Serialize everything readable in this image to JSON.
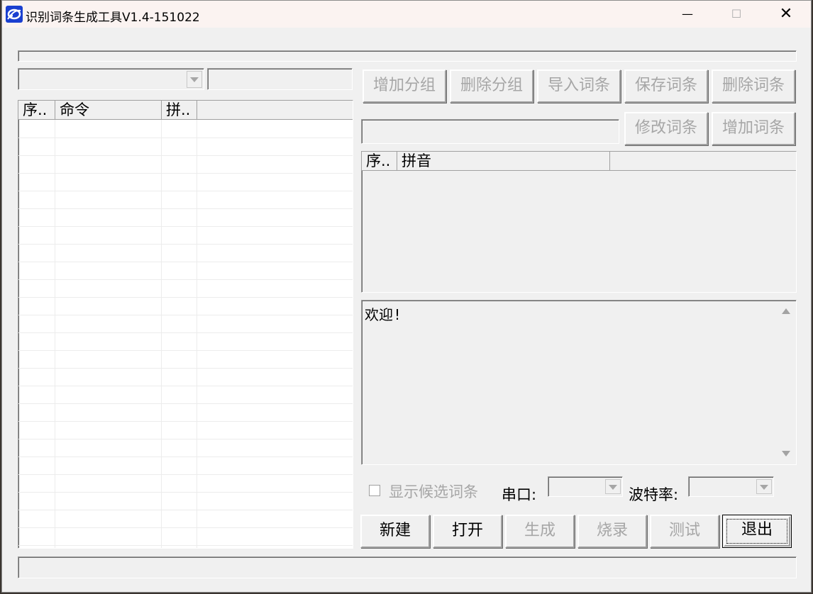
{
  "window": {
    "title": "识别词条生成工具V1.4-151022",
    "minimize_glyph": "—",
    "maximize_glyph": "☐",
    "close_glyph": "✕"
  },
  "left_panel": {
    "group_combo": {
      "value": ""
    },
    "group_name_input": {
      "value": ""
    },
    "command_table": {
      "columns": [
        "序..",
        "命令",
        "拼..",
        ""
      ],
      "rows": []
    }
  },
  "toolbar": {
    "add_group": "增加分组",
    "delete_group": "删除分组",
    "import_words": "导入词条",
    "save_words": "保存词条",
    "delete_word": "删除词条",
    "modify_word": "修改词条",
    "add_word": "增加词条"
  },
  "word_input": {
    "value": ""
  },
  "pinyin_table": {
    "columns": [
      "序..",
      "拼音",
      ""
    ],
    "rows": []
  },
  "log": {
    "text": "欢迎!"
  },
  "options": {
    "show_candidates_label": "显示候选词条",
    "show_candidates_checked": false,
    "serial_port_label": "串口:",
    "serial_port_value": "",
    "baud_rate_label": "波特率:",
    "baud_rate_value": ""
  },
  "actions": {
    "new": "新建",
    "open": "打开",
    "generate": "生成",
    "burn": "烧录",
    "test": "测试",
    "exit": "退出"
  },
  "colors": {
    "window_bg": "#f0f0f0",
    "titlebar_bg": "#fbf3f1",
    "disabled_text": "#a6a6a6",
    "icon_blue": "#1a3fd0"
  }
}
